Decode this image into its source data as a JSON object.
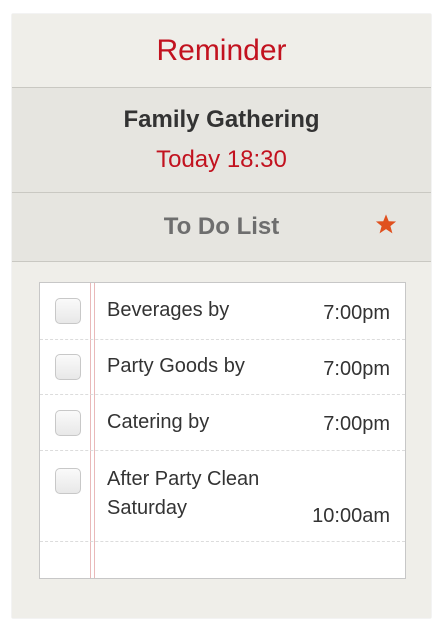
{
  "header": {
    "title": "Reminder"
  },
  "event": {
    "title": "Family Gathering",
    "time": "Today 18:30"
  },
  "todo": {
    "title": "To Do List",
    "star_icon": "star-icon",
    "star_color": "#e0501e"
  },
  "tasks": [
    {
      "label": "Beverages by",
      "time": "7:00pm",
      "checked": false
    },
    {
      "label": "Party Goods by",
      "time": "7:00pm",
      "checked": false
    },
    {
      "label": "Catering by",
      "time": "7:00pm",
      "checked": false
    },
    {
      "label_line1": "After Party Clean",
      "label_line2": "Saturday",
      "time": "10:00am",
      "checked": false
    }
  ]
}
